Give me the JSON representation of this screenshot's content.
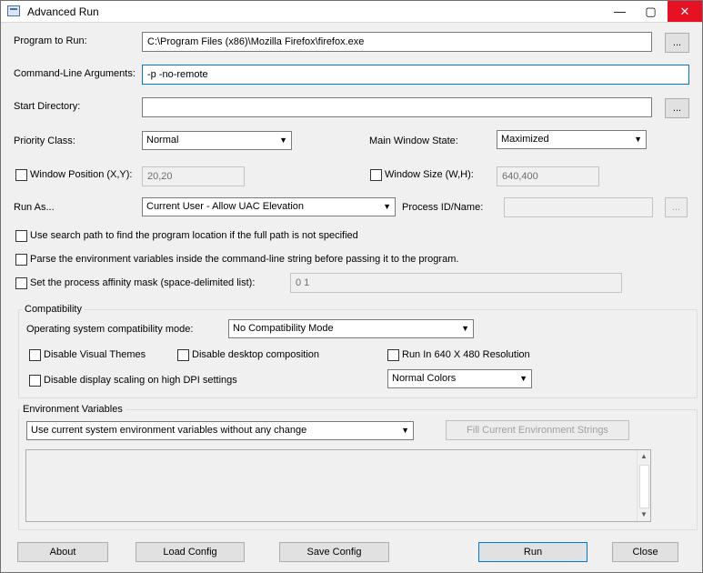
{
  "window": {
    "title": "Advanced Run",
    "minimize_glyph": "—",
    "maximize_glyph": "▢",
    "close_glyph": "✕",
    "close_hover_color": "#e81123"
  },
  "program": {
    "label": "Program to Run:",
    "value": "C:\\Program Files (x86)\\Mozilla Firefox\\firefox.exe",
    "browse": "..."
  },
  "args": {
    "label": "Command-Line Arguments:",
    "value": "-p -no-remote"
  },
  "startdir": {
    "label": "Start Directory:",
    "value": "",
    "browse": "..."
  },
  "priority": {
    "label": "Priority Class:",
    "value": "Normal"
  },
  "window_state": {
    "label": "Main Window State:",
    "value": "Maximized"
  },
  "window_position": {
    "checked": false,
    "label": "Window Position (X,Y):",
    "value": "20,20"
  },
  "window_size": {
    "checked": false,
    "label": "Window Size (W,H):",
    "value": "640,400"
  },
  "run_as": {
    "label": "Run As...",
    "value": "Current User - Allow UAC Elevation",
    "pid_label": "Process ID/Name:",
    "pid_value": "",
    "pid_browse": "..."
  },
  "options": {
    "search_path": {
      "checked": false,
      "label": "Use search path to find the program location if the full path is not specified"
    },
    "parse_env": {
      "checked": false,
      "label": "Parse the environment variables inside the command-line string before passing it to the program."
    },
    "affinity": {
      "checked": false,
      "label": "Set the process affinity mask (space-delimited list):",
      "value": "0 1"
    }
  },
  "compatibility": {
    "title": "Compatibility",
    "os_mode_label": "Operating system compatibility mode:",
    "os_mode_value": "No Compatibility Mode",
    "disable_visual_themes": {
      "checked": false,
      "label": "Disable Visual Themes"
    },
    "disable_desktop_composition": {
      "checked": false,
      "label": "Disable desktop composition"
    },
    "run_640x480": {
      "checked": false,
      "label": "Run In 640 X 480 Resolution"
    },
    "disable_dpi_scaling": {
      "checked": false,
      "label": "Disable display scaling on high DPI settings"
    },
    "colors_value": "Normal Colors"
  },
  "env": {
    "title": "Environment Variables",
    "mode_value": "Use current system environment variables without any change",
    "fill_button": "Fill Current Environment Strings",
    "text": ""
  },
  "buttons": {
    "about": "About",
    "load": "Load Config",
    "save": "Save Config",
    "run": "Run",
    "close": "Close"
  }
}
